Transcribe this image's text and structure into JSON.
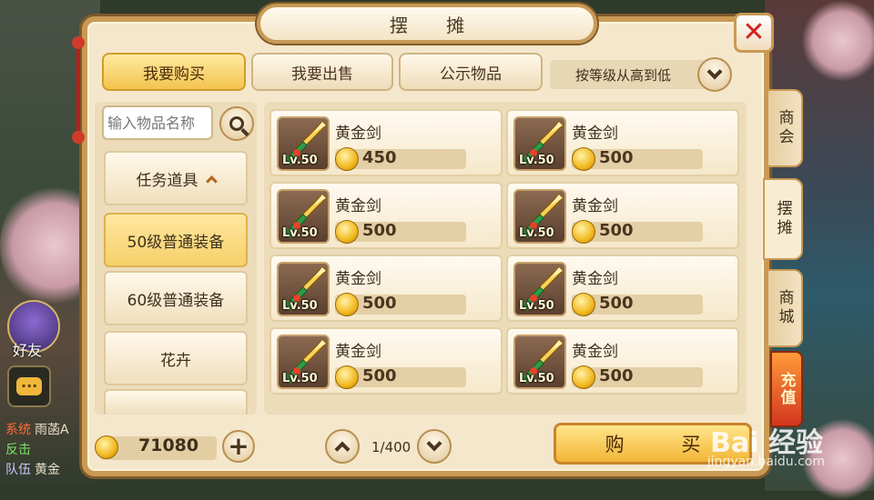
{
  "window": {
    "title": "摆 摊"
  },
  "tabs": [
    {
      "label": "我要购买",
      "active": true
    },
    {
      "label": "我要出售",
      "active": false
    },
    {
      "label": "公示物品",
      "active": false
    }
  ],
  "sort": {
    "label": "按等级从高到低"
  },
  "search": {
    "placeholder": "输入物品名称"
  },
  "categories": [
    {
      "label": "任务道具",
      "expanded": true
    },
    {
      "label": "50级普通装备",
      "active": true
    },
    {
      "label": "60级普通装备"
    },
    {
      "label": "花卉"
    }
  ],
  "items": [
    {
      "name": "黄金剑",
      "level": "Lv.50",
      "price": "450"
    },
    {
      "name": "黄金剑",
      "level": "Lv.50",
      "price": "500"
    },
    {
      "name": "黄金剑",
      "level": "Lv.50",
      "price": "500"
    },
    {
      "name": "黄金剑",
      "level": "Lv.50",
      "price": "500"
    },
    {
      "name": "黄金剑",
      "level": "Lv.50",
      "price": "500"
    },
    {
      "name": "黄金剑",
      "level": "Lv.50",
      "price": "500"
    },
    {
      "name": "黄金剑",
      "level": "Lv.50",
      "price": "500"
    },
    {
      "name": "黄金剑",
      "level": "Lv.50",
      "price": "500"
    }
  ],
  "side_tabs": [
    {
      "label": "商会"
    },
    {
      "label": "摆摊",
      "active": true
    },
    {
      "label": "商城"
    }
  ],
  "recharge": {
    "label": "充值"
  },
  "wallet": {
    "amount": "71080"
  },
  "pagination": {
    "label": "1/400"
  },
  "buy_button": {
    "label": "购 买"
  },
  "chat": {
    "friend_label": "好友",
    "lines": [
      {
        "tag": "系统",
        "text": "雨菡A"
      },
      {
        "tag": "反击",
        "text": ""
      },
      {
        "tag": "队伍",
        "text": "黄金"
      }
    ]
  },
  "watermark": {
    "brand": "Bai 经验",
    "url": "jingyan.baidu.com"
  },
  "colors": {
    "panel": "#f5e7cc",
    "frame": "#c99a55",
    "active_tab": "#f3c44e",
    "close": "#d2231e"
  }
}
